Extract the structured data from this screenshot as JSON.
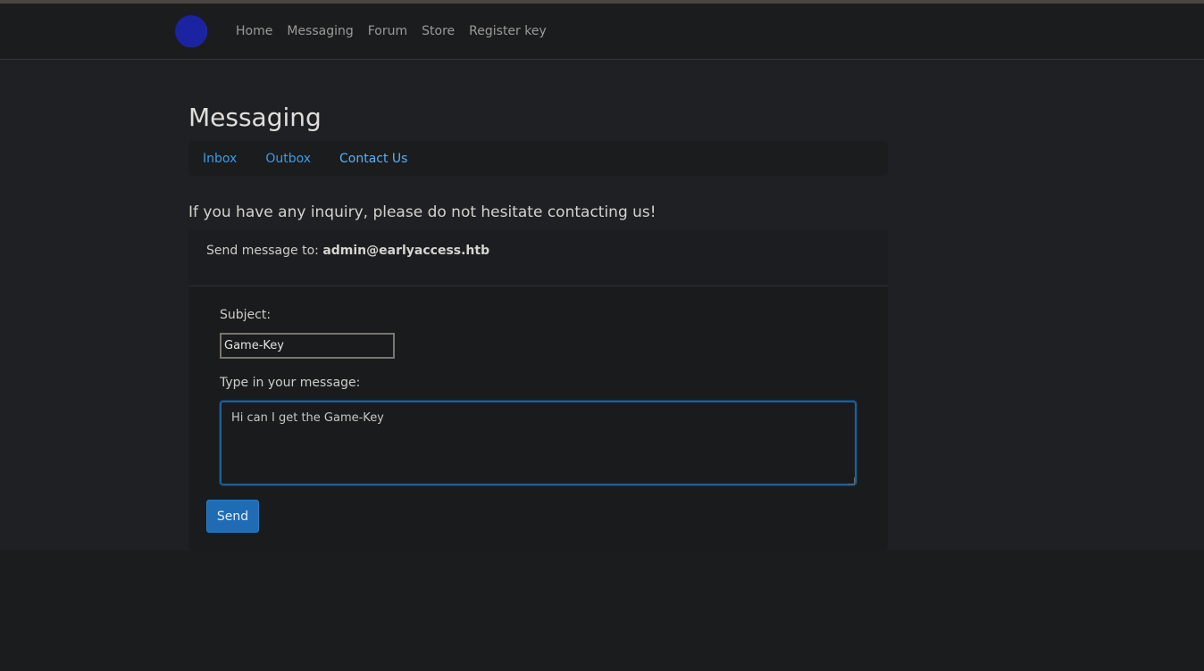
{
  "nav": {
    "links": [
      "Home",
      "Messaging",
      "Forum",
      "Store",
      "Register key"
    ]
  },
  "page": {
    "title": "Messaging",
    "tabs": [
      "Inbox",
      "Outbox",
      "Contact Us"
    ],
    "intro": "If you have any inquiry, please do not hesitate contacting us!"
  },
  "form": {
    "send_to_label": "Send message to:",
    "send_to_address": "admin@earlyaccess.htb",
    "subject_label": "Subject:",
    "subject_value": "Game-Key",
    "message_label": "Type in your message:",
    "message_value": "Hi can I get the Game-Key",
    "send_label": "Send"
  },
  "colors": {
    "accent": "#1f6cb4",
    "link": "#3f9be0",
    "background": "#1f2023"
  },
  "icons": {
    "logo": "moon-logo-icon"
  }
}
